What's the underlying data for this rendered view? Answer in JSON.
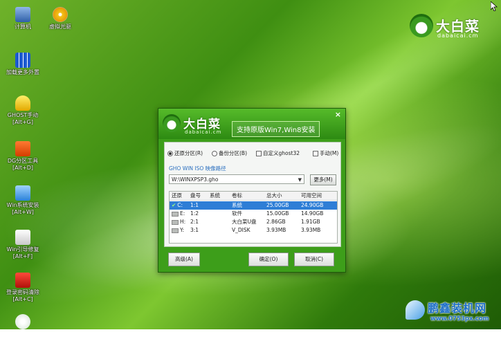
{
  "desktop": {
    "icons": [
      {
        "label": "计算机",
        "icon": "computer-icon"
      },
      {
        "label": "虚拟光驱",
        "icon": "cd-icon"
      },
      {
        "label": "加载更多外置",
        "icon": "grid-icon"
      },
      {
        "label": "GHOST手动",
        "line2": "[Alt+G]",
        "icon": "ghost-icon"
      },
      {
        "label": "DG分区工具",
        "line2": "[Alt+D]",
        "icon": "dg-icon"
      },
      {
        "label": "Win系统安装",
        "line2": "[Alt+W]",
        "icon": "win-install-icon"
      },
      {
        "label": "Win引导修复",
        "line2": "[Alt+F]",
        "icon": "boot-repair-icon"
      },
      {
        "label": "登录密码清除",
        "line2": "[Alt+C]",
        "icon": "password-icon"
      },
      {
        "label": "",
        "icon": "leaf-icon"
      }
    ]
  },
  "brand": {
    "name": "大白菜",
    "sub": "dabaicai.cm"
  },
  "dialog": {
    "brand_name": "大白菜",
    "brand_sub": "dabaicai.cm",
    "slogan": "支持原版Win7,Win8安装",
    "close": "×",
    "options": {
      "restore": "还原分区(R)",
      "backup": "备份分区(B)",
      "custom": "自定义ghost32",
      "manual": "手动(M)"
    },
    "path_label": "GHO WIN ISO 映像路径",
    "path_value": "W:\\WINXPSP3.gho",
    "more_button": "更多(M)",
    "table": {
      "headers": [
        "还原",
        "盘号",
        "系统",
        "卷标",
        "总大小",
        "可用空间"
      ],
      "rows": [
        {
          "drive": "C:",
          "num": "1:1",
          "label": "系统",
          "total": "25.00GB",
          "free": "24.90GB",
          "selected": true
        },
        {
          "drive": "E:",
          "num": "1:2",
          "label": "软件",
          "total": "15.00GB",
          "free": "14.90GB",
          "selected": false
        },
        {
          "drive": "H:",
          "num": "2:1",
          "label": "大白菜U盘",
          "total": "2.86GB",
          "free": "1.91GB",
          "selected": false
        },
        {
          "drive": "Y:",
          "num": "3:1",
          "label": "V_DISK",
          "total": "3.93MB",
          "free": "3.93MB",
          "selected": false
        }
      ]
    },
    "buttons": {
      "advanced": "高级(A)",
      "ok": "确定(O)",
      "cancel": "取消(C)"
    }
  },
  "watermark": {
    "text": "鹏鑫装机网",
    "url": "www.0753px.com"
  }
}
